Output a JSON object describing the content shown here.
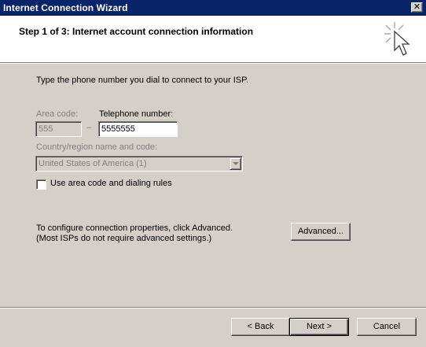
{
  "window": {
    "title": "Internet Connection Wizard",
    "close_glyph": "✕"
  },
  "header": {
    "step_title": "Step 1 of 3: Internet account connection information",
    "icon": "wizard-sparkle-cursor-icon"
  },
  "main": {
    "instruction": "Type the phone number you dial to connect to your ISP.",
    "area_code": {
      "label": "Area code:",
      "value": "555",
      "enabled": false
    },
    "dash": "–",
    "telephone": {
      "label": "Telephone number:",
      "value": "5555555",
      "enabled": true
    },
    "country": {
      "label": "Country/region name and code:",
      "selected": "United States of America (1)",
      "enabled": false
    },
    "use_area_code": {
      "label": "Use area code and dialing rules",
      "checked": false
    },
    "advanced_note_line1": "To configure connection properties, click Advanced.",
    "advanced_note_line2": "(Most ISPs do not require advanced settings.)",
    "advanced_button": "Advanced..."
  },
  "footer": {
    "back_button": "< Back",
    "next_button": "Next >",
    "cancel_button": "Cancel"
  },
  "colors": {
    "titlebar": "#0a246a",
    "dialog_face": "#d4d0c8",
    "disabled_text": "#808080"
  }
}
